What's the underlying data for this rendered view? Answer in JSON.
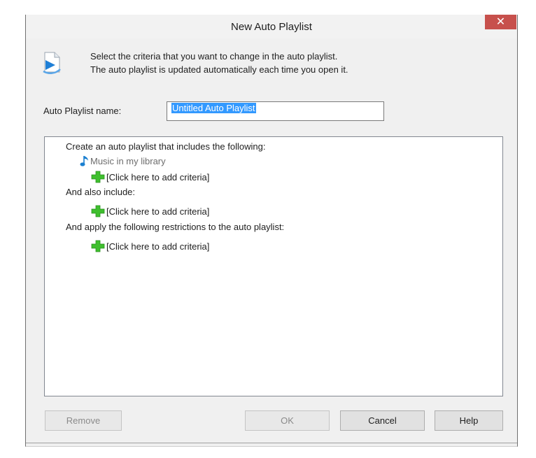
{
  "window": {
    "title": "New Auto Playlist",
    "close_glyph": "✕"
  },
  "header": {
    "icon": "auto-playlist-icon",
    "line1": "Select the criteria that you want to change in the auto playlist.",
    "line2": "The auto playlist is updated automatically each time you open it."
  },
  "name_field": {
    "label": "Auto Playlist name:",
    "value": "Untitled Auto Playlist"
  },
  "criteria": {
    "section1_heading": "Create an auto playlist that includes the following:",
    "music_item": "Music in my library",
    "add_criteria": "[Click here to add criteria]",
    "section2_heading": "And also include:",
    "section3_heading": "And apply the following restrictions to the auto playlist:"
  },
  "buttons": {
    "remove": "Remove",
    "ok": "OK",
    "cancel": "Cancel",
    "help": "Help"
  },
  "colors": {
    "accent_selection": "#3399ff",
    "close_button": "#c7504c",
    "plus_green": "#3fbf2e",
    "note_blue": "#1a7fd0"
  }
}
